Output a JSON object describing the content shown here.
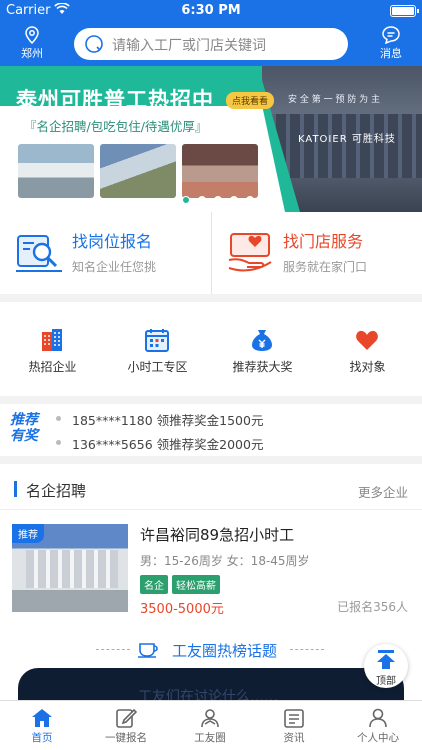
{
  "status_bar": {
    "carrier": "Carrier",
    "time": "6:30 PM"
  },
  "nav": {
    "location": "郑州",
    "search_placeholder": "请输入工厂或门店关键词",
    "message": "消息"
  },
  "banner": {
    "title": "泰州可胜普工热招中",
    "tag": "点我看看",
    "subtitle": "『名企招聘/包吃包住/待遇优厚』",
    "sign_text": "安 全 第 一    预 防 为 主",
    "company_sign": "KATOIER 可胜科技",
    "active_dot": 1,
    "dot_count": 5
  },
  "services": [
    {
      "title": "找岗位报名",
      "subtitle": "知名企业任您挑",
      "color": "#1a72e6",
      "icon": "search-doc-icon"
    },
    {
      "title": "找门店服务",
      "subtitle": "服务就在家门口",
      "color": "#e8472a",
      "icon": "heart-hand-icon"
    }
  ],
  "categories": [
    {
      "label": "热招企业",
      "icon": "building-icon"
    },
    {
      "label": "小时工专区",
      "icon": "calendar-icon"
    },
    {
      "label": "推荐获大奖",
      "icon": "money-bag-icon"
    },
    {
      "label": "找对象",
      "icon": "heart-icon"
    }
  ],
  "ticker": {
    "badge_line1": "推荐",
    "badge_line2": "有奖",
    "items": [
      "185****1180 领推荐奖金1500元",
      "136****5656 领推荐奖金2000元"
    ]
  },
  "section": {
    "title": "名企招聘",
    "more": "更多企业"
  },
  "job": {
    "ribbon": "推荐",
    "name": "许昌裕同89急招小时工",
    "requirement": "男：15-26周岁 女：18-45周岁",
    "tags": [
      "名企",
      "轻松高薪"
    ],
    "salary": "3500-5000元",
    "enrolled": "已报名356人"
  },
  "topic": {
    "title": "工友圈热榜话题",
    "preview": "工友们在讨论什么……"
  },
  "to_top": "顶部",
  "tabs": [
    {
      "label": "首页",
      "icon": "home-icon",
      "active": true
    },
    {
      "label": "一键报名",
      "icon": "edit-icon",
      "active": false
    },
    {
      "label": "工友圈",
      "icon": "people-icon",
      "active": false
    },
    {
      "label": "资讯",
      "icon": "news-icon",
      "active": false
    },
    {
      "label": "个人中心",
      "icon": "user-icon",
      "active": false
    }
  ]
}
